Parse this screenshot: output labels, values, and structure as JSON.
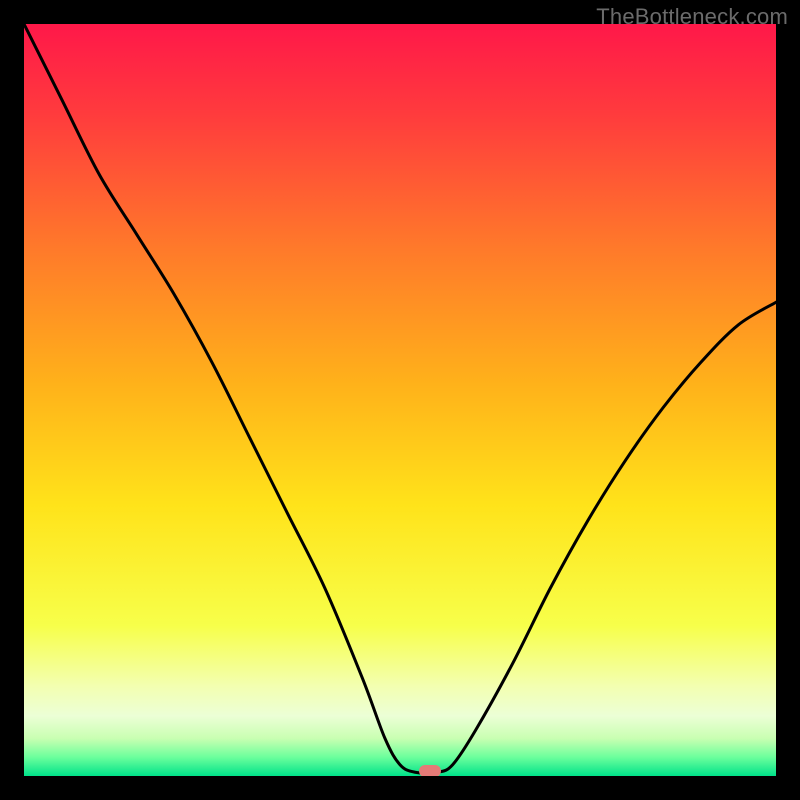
{
  "watermark": "TheBottleneck.com",
  "colors": {
    "frame": "#000000",
    "watermark_text": "#6b6b6b",
    "curve": "#000000",
    "marker": "#e47a77",
    "gradient_stops": [
      {
        "offset": 0.0,
        "color": "#ff1849"
      },
      {
        "offset": 0.12,
        "color": "#ff3b3d"
      },
      {
        "offset": 0.3,
        "color": "#ff7a2a"
      },
      {
        "offset": 0.48,
        "color": "#ffb21a"
      },
      {
        "offset": 0.64,
        "color": "#ffe31a"
      },
      {
        "offset": 0.8,
        "color": "#f7ff4a"
      },
      {
        "offset": 0.88,
        "color": "#f3ffb0"
      },
      {
        "offset": 0.92,
        "color": "#ecffd6"
      },
      {
        "offset": 0.95,
        "color": "#c9ffb2"
      },
      {
        "offset": 0.975,
        "color": "#6cff9c"
      },
      {
        "offset": 1.0,
        "color": "#00e28a"
      }
    ]
  },
  "chart_data": {
    "type": "line",
    "title": "",
    "xlabel": "",
    "ylabel": "",
    "xlim": [
      0,
      100
    ],
    "ylim": [
      0,
      100
    ],
    "grid": false,
    "legend": false,
    "series": [
      {
        "name": "bottleneck-curve",
        "x": [
          0,
          5,
          10,
          15,
          20,
          25,
          30,
          35,
          40,
          45,
          48,
          50,
          52,
          55,
          57,
          60,
          65,
          70,
          75,
          80,
          85,
          90,
          95,
          100
        ],
        "y": [
          100,
          90,
          80,
          72,
          64,
          55,
          45,
          35,
          25,
          13,
          5,
          1.5,
          0.5,
          0.5,
          1.5,
          6,
          15,
          25,
          34,
          42,
          49,
          55,
          60,
          63
        ]
      }
    ],
    "annotations": [
      {
        "name": "minimum-marker",
        "x": 54,
        "y": 0.7
      }
    ]
  }
}
